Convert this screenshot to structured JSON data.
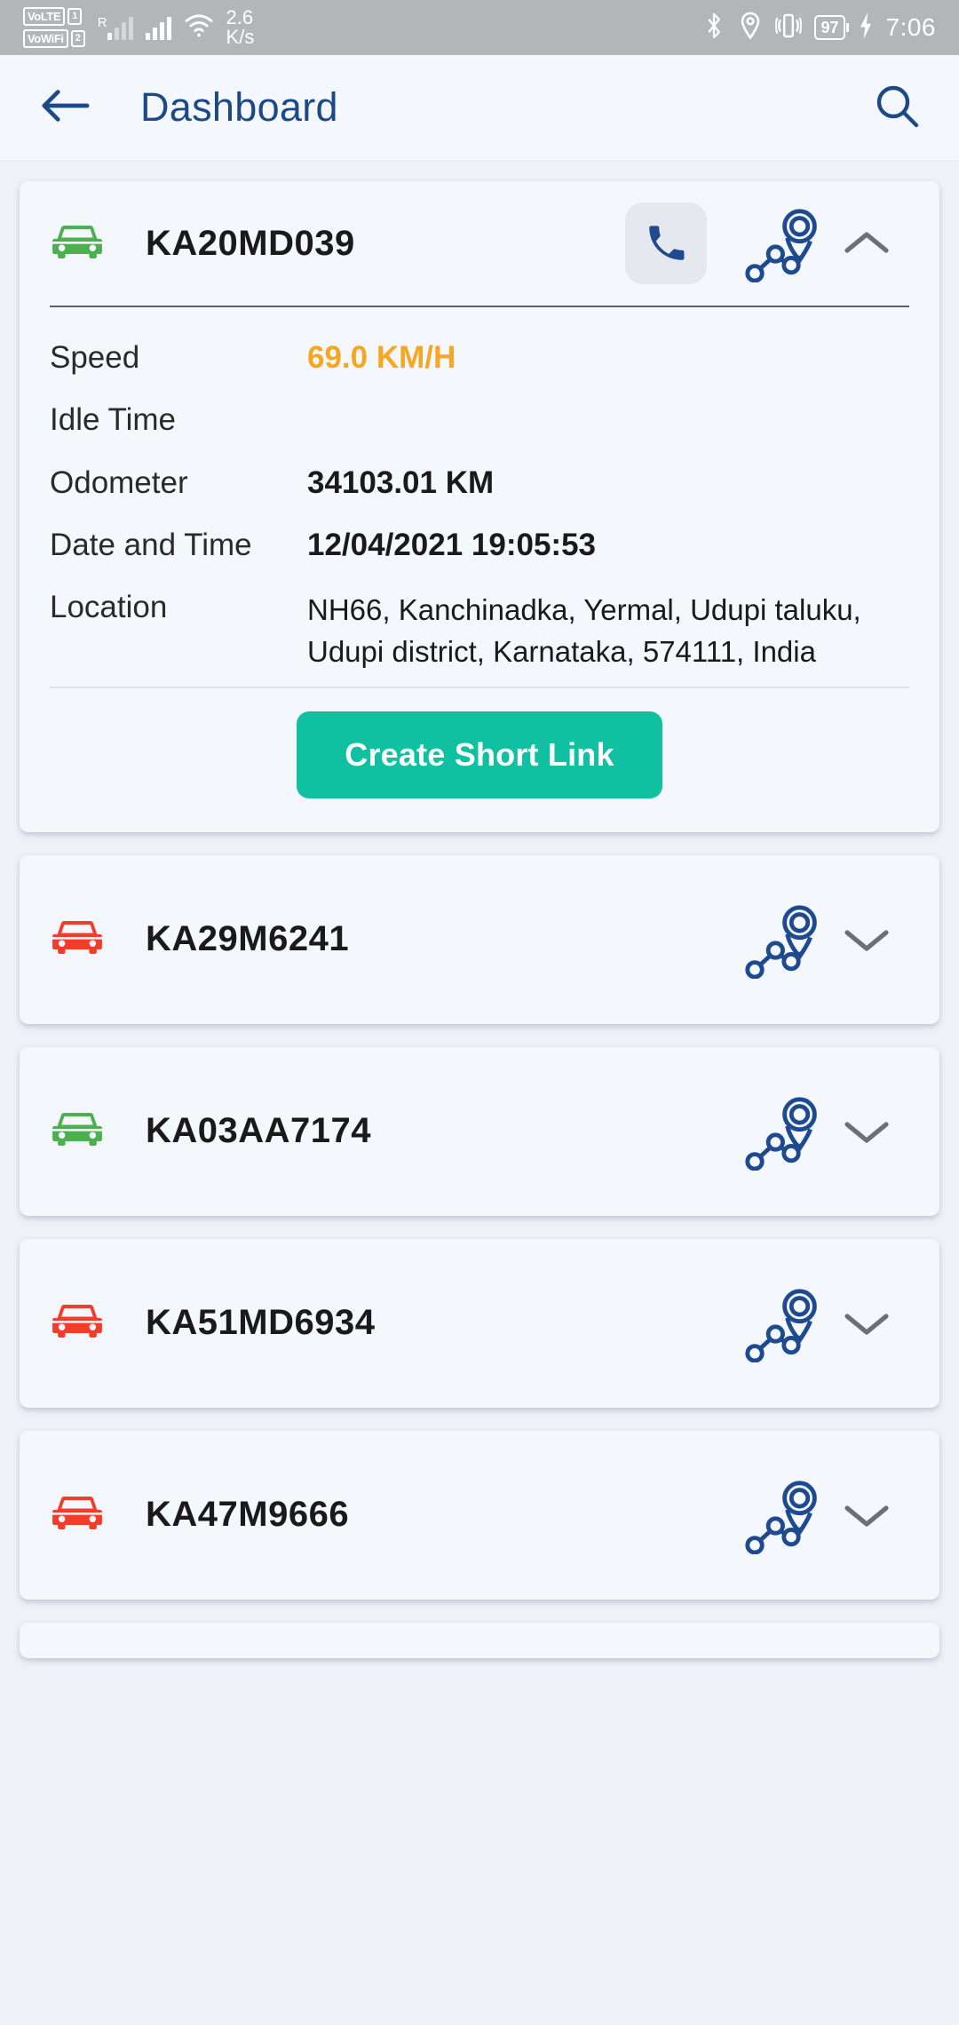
{
  "status_bar": {
    "sim1_label": "VoLTE",
    "sim1_num": "1",
    "sim2_label": "VoWiFi",
    "sim2_num": "2",
    "roaming_label": "R",
    "net_speed_value": "2.6",
    "net_speed_unit": "K/s",
    "battery_percent": "97",
    "clock": "7:06"
  },
  "app_bar": {
    "back_icon": "arrow-left-icon",
    "title": "Dashboard",
    "search_icon": "search-icon"
  },
  "theme": {
    "accent_blue": "#1c4a86",
    "teal": "#0fc1a1",
    "orange": "#f5a623",
    "green": "#4caf50",
    "red": "#f03e2b",
    "card_bg": "#f4f7fc",
    "page_bg": "#eef2f8"
  },
  "expanded_vehicle": {
    "status_color": "green",
    "plate": "KA20MD039",
    "call_icon": "phone-icon",
    "route_icon": "route-pin-icon",
    "collapse_icon": "chevron-up-icon",
    "details": [
      {
        "label": "Speed",
        "value": "69.0 KM/H",
        "style": "speed"
      },
      {
        "label": "Idle Time",
        "value": "",
        "style": "plain"
      },
      {
        "label": "Odometer",
        "value": "34103.01 KM",
        "style": "plain"
      },
      {
        "label": "Date and Time",
        "value": "12/04/2021 19:05:53",
        "style": "plain"
      },
      {
        "label": "Location",
        "value": "NH66, Kanchinadka, Yermal, Udupi taluku, Udupi district, Karnataka, 574111, India",
        "style": "loc"
      }
    ],
    "short_link_button": "Create Short Link"
  },
  "collapsed_vehicles": [
    {
      "plate": "KA29M6241",
      "status_color": "red",
      "route_icon": "route-pin-icon",
      "expand_icon": "chevron-down-icon"
    },
    {
      "plate": "KA03AA7174",
      "status_color": "green",
      "route_icon": "route-pin-icon",
      "expand_icon": "chevron-down-icon"
    },
    {
      "plate": "KA51MD6934",
      "status_color": "red",
      "route_icon": "route-pin-icon",
      "expand_icon": "chevron-down-icon"
    },
    {
      "plate": "KA47M9666",
      "status_color": "red",
      "route_icon": "route-pin-icon",
      "expand_icon": "chevron-down-icon"
    }
  ]
}
